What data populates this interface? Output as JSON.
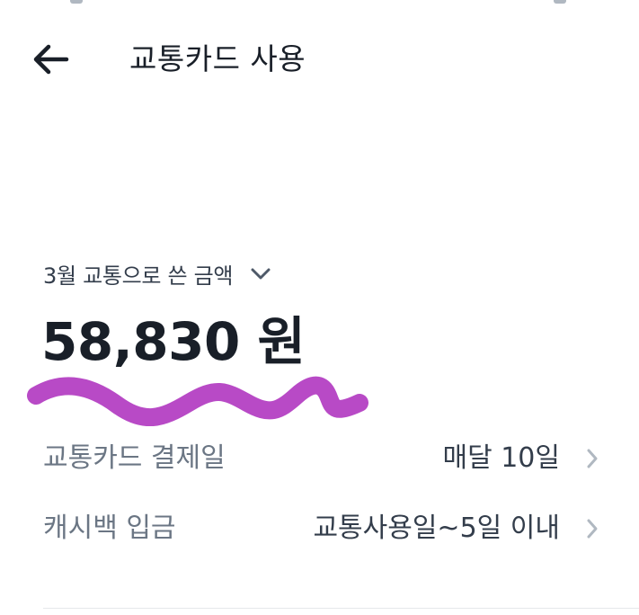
{
  "header": {
    "title": "교통카드 사용",
    "back_icon": "arrow-left-icon"
  },
  "summary": {
    "period_label": "3월 교통으로 쓴 금액",
    "dropdown_icon": "chevron-down-icon",
    "amount": "58,830 원"
  },
  "details": [
    {
      "label": "교통카드 결제일",
      "value": "매달 10일",
      "icon": "chevron-right-icon"
    },
    {
      "label": "캐시백 입금",
      "value": "교통사용일~5일 이내",
      "icon": "chevron-right-icon"
    }
  ],
  "colors": {
    "text_primary": "#191f28",
    "text_secondary": "#6b7684",
    "text_value": "#333d4b",
    "chevron": "#b0b8c1",
    "annotation_scribble": "#b84ac6",
    "divider": "#e5e8eb"
  }
}
